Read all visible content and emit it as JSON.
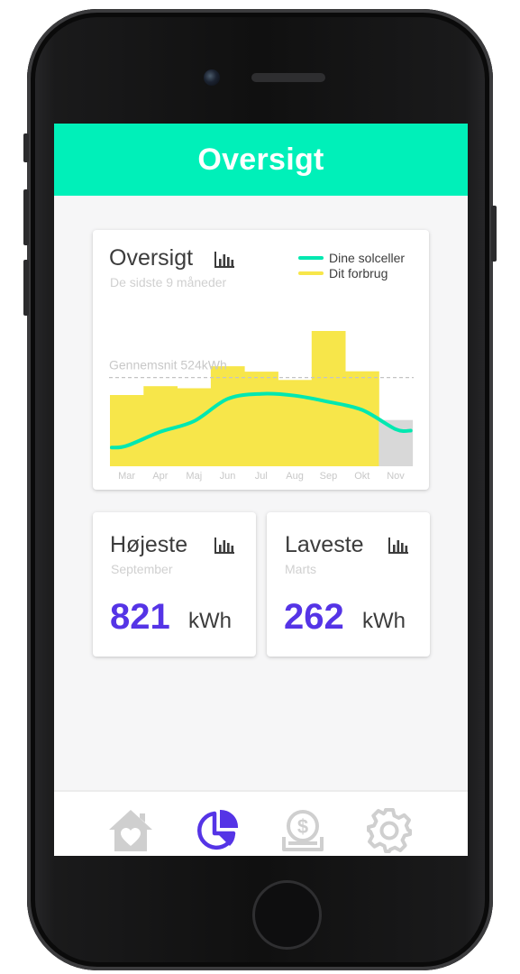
{
  "header": {
    "title": "Oversigt"
  },
  "overview": {
    "title": "Oversigt",
    "subtitle": "De sidste 9 måneder",
    "legend": [
      {
        "label": "Dine solceller",
        "color": "#00e8b0"
      },
      {
        "label": "Dit forbrug",
        "color": "#f7e64a"
      }
    ]
  },
  "chart_data": {
    "type": "bar",
    "categories": [
      "Mar",
      "Apr",
      "Maj",
      "Jun",
      "Jul",
      "Aug",
      "Sep",
      "Okt",
      "Nov"
    ],
    "series": [
      {
        "name": "Dit forbrug",
        "values": [
          465,
          495,
          488,
          562,
          544,
          516,
          681,
          545,
          381
        ]
      },
      {
        "name": "Dine solceller",
        "values": [
          294,
          341,
          377,
          452,
          469,
          463,
          442,
          415,
          350
        ]
      }
    ],
    "ylim": [
      225,
      760
    ],
    "average": {
      "label": "Gennemsnit 524kWh",
      "value": 524
    },
    "colors": {
      "bar": "#f7e64a",
      "bar_current": "#d8d8d8",
      "line": "#00e8b0",
      "average": "#c4c4c4"
    }
  },
  "highest": {
    "title": "Højeste",
    "month": "September",
    "value": "821",
    "unit": "kWh"
  },
  "lowest": {
    "title": "Laveste",
    "month": "Marts",
    "value": "262",
    "unit": "kWh"
  },
  "tabs": [
    {
      "icon": "home-heart-icon",
      "active": false
    },
    {
      "icon": "pie-chart-icon",
      "active": true
    },
    {
      "icon": "money-icon",
      "active": false
    },
    {
      "icon": "gear-icon",
      "active": false
    }
  ],
  "colors": {
    "accent": "#00f0b9",
    "primary": "#5534e6",
    "inactive": "#cfcfcf"
  }
}
